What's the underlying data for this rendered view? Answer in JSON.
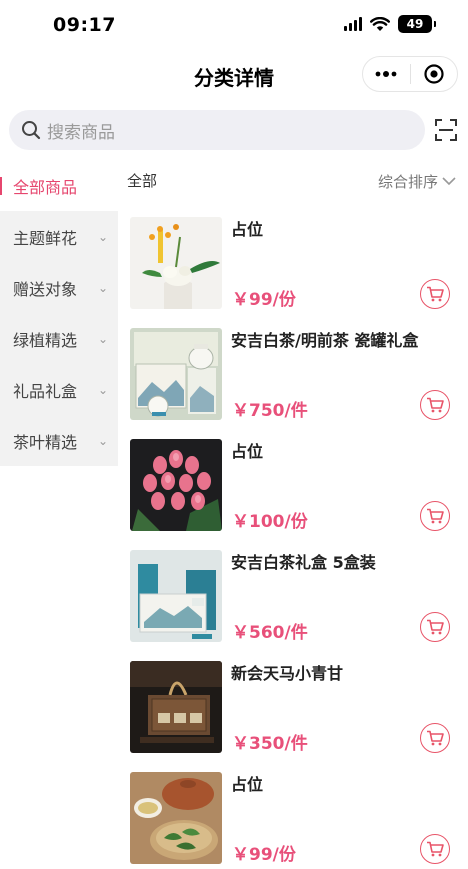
{
  "status_bar": {
    "time": "09:17",
    "battery": "49"
  },
  "nav": {
    "title": "分类详情",
    "more_icon": "more-dots-icon",
    "close_icon": "target-circle-icon"
  },
  "search": {
    "placeholder": "搜索商品",
    "scan_icon": "scan-icon"
  },
  "sidebar": {
    "items": [
      {
        "label": "全部商品",
        "active": true
      },
      {
        "label": "主题鲜花"
      },
      {
        "label": "赠送对象"
      },
      {
        "label": "绿植精选"
      },
      {
        "label": "礼品礼盒"
      },
      {
        "label": "茶叶精选"
      }
    ]
  },
  "content": {
    "category_label": "全部",
    "sort_label": "综合排序",
    "products": [
      {
        "name": "占位",
        "price": "￥99/份"
      },
      {
        "name": "安吉白茶/明前茶 瓷罐礼盒",
        "price": "￥750/件"
      },
      {
        "name": "占位",
        "price": "￥100/份"
      },
      {
        "name": "安吉白茶礼盒 5盒装",
        "price": "￥560/件"
      },
      {
        "name": "新会天马小青甘",
        "price": "￥350/件"
      },
      {
        "name": "占位",
        "price": "￥99/份"
      }
    ]
  },
  "colors": {
    "accent": "#e6466e",
    "price": "#e8507a",
    "cart": "#e85468"
  }
}
